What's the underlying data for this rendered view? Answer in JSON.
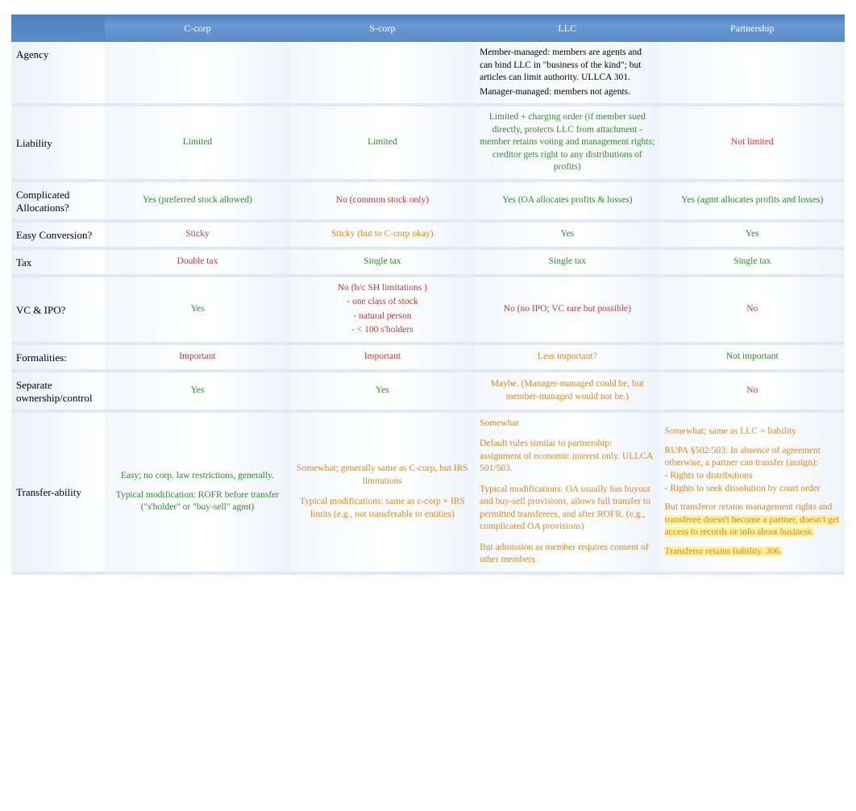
{
  "columns": {
    "c": "C-corp",
    "s": "S-corp",
    "llc": "LLC",
    "p": "Partnership"
  },
  "rows": {
    "agency": {
      "label": "Agency",
      "c": "",
      "s": "",
      "llc_l1": "Member-managed: members are agents and can bind LLC in \"business of the kind\"; but articles can limit authority.  ULLCA 301.",
      "llc_l2": "Manager-managed: members not agents.",
      "p": ""
    },
    "liability": {
      "label": "Liability",
      "c": "Limited",
      "s": "Limited",
      "llc": "Limited + charging order (if member sued directly, protects LLC from attachment - member retains voting and management rights; creditor gets right to any distributions of profits)",
      "p": "Not limited"
    },
    "alloc": {
      "label": "Complicated Allocations?",
      "c": "Yes (preferred stock allowed)",
      "s": "No (common stock only)",
      "llc": "Yes (OA allocates profits & losses)",
      "p": "Yes (agmt allocates profits and losses)"
    },
    "conv": {
      "label": "Easy Conversion?",
      "c": "Sticky",
      "s": "Sticky (but to C-corp okay)",
      "llc": "Yes",
      "p": "Yes"
    },
    "tax": {
      "label": "Tax",
      "c": "Double tax",
      "s": "Single tax",
      "llc": "Single tax",
      "p": "Single tax"
    },
    "vc": {
      "label": "VC & IPO?",
      "c": "Yes",
      "s_l1": "No (b/c SH limitations )",
      "s_l2": "- one class of stock",
      "s_l3": "- natural person",
      "s_l4": "- < 100 s'holders",
      "llc": "No (no IPO; VC rare but possible)",
      "p": "No"
    },
    "form": {
      "label": "Formalities:",
      "c": "Important",
      "s": "Important",
      "llc": "Less important?",
      "p": "Not important"
    },
    "sep": {
      "label": "Separate ownership/control",
      "c": "Yes",
      "s": "Yes",
      "llc": "Maybe. (Manager-managed could be, but member-managed would not be.)",
      "p": "No"
    },
    "transfer": {
      "label": "Transfer-ability",
      "c_l1": "Easy; no corp. law restrictions, generally.",
      "c_l2": "Typical modification: ROFR before transfer (\"s'holder\" or \"buy-sell\" agmt)",
      "s_l1": "Somewhat; generally same as C-corp, but IRS limitations",
      "s_l2": "Typical modifications: same as c-corp + IRS limits (e.g., not transferable to entities)",
      "llc_l1": "Somewhat",
      "llc_l2": "Default rules similar to partnership: assignment of economic interest only.   ULLCA 501/503.",
      "llc_l3": "Typical modifications: OA usually has buyout and buy-sell provisions, allows full transfer to permitted transferees, and after ROFR. (e.g., complicated OA provisions)",
      "llc_l4": "But admission as member requires consent of other members.",
      "p_l1": "Somewhat; same as LLC + liability",
      "p_l2": "RUPA §502/503: In absence of agreement otherwise, a partner can transfer (assign):",
      "p_l3": "- Rights to distributions",
      "p_l4": "- Rights to seek dissolution by court order",
      "p_l5": "But transferor retains management rights and",
      "p_hl1": "transferee doesn't become a partner, doesn't get",
      "p_hl2": "access to records or info about business.",
      "p_hl3": "Transferor retains liability. 306."
    }
  }
}
